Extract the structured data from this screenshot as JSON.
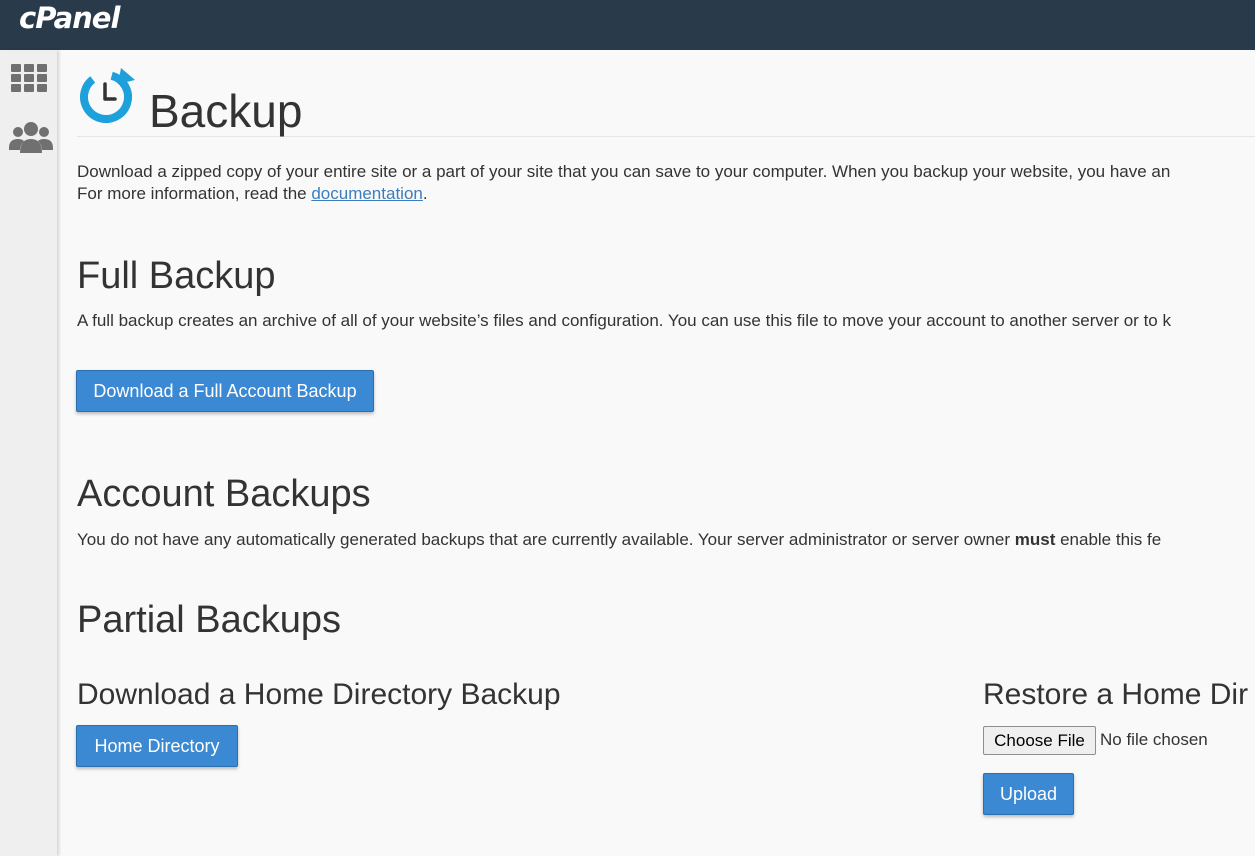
{
  "brand": {
    "logo_text": "cPanel"
  },
  "sidebar": {
    "items": [
      {
        "name": "apps-grid-icon"
      },
      {
        "name": "users-icon"
      }
    ]
  },
  "page": {
    "title": "Backup",
    "accent_color": "#1ea0dc"
  },
  "intro": {
    "line1": "Download a zipped copy of your entire site or a part of your site that you can save to your computer. When you backup your website, you have an",
    "line2_prefix": "For more information, read the ",
    "line2_link": "documentation",
    "line2_suffix": "."
  },
  "full_backup": {
    "heading": "Full Backup",
    "description": "A full backup creates an archive of all of your website’s files and configuration. You can use this file to move your account to another server or to k",
    "button_label": "Download a Full Account Backup"
  },
  "account_backups": {
    "heading": "Account Backups",
    "description_prefix": "You do not have any automatically generated backups that are currently available. Your server administrator or server owner ",
    "description_bold": "must",
    "description_suffix": " enable this fe"
  },
  "partial_backups": {
    "heading": "Partial Backups",
    "download_home": {
      "heading": "Download a Home Directory Backup",
      "button_label": "Home Directory"
    },
    "restore_home": {
      "heading": "Restore a Home Dir",
      "choose_file_label": "Choose File",
      "file_status": "No file chosen",
      "upload_label": "Upload"
    }
  },
  "colors": {
    "topbar": "#293a4a",
    "primary_button": "#3b89d3",
    "link": "#3b7dbd"
  }
}
